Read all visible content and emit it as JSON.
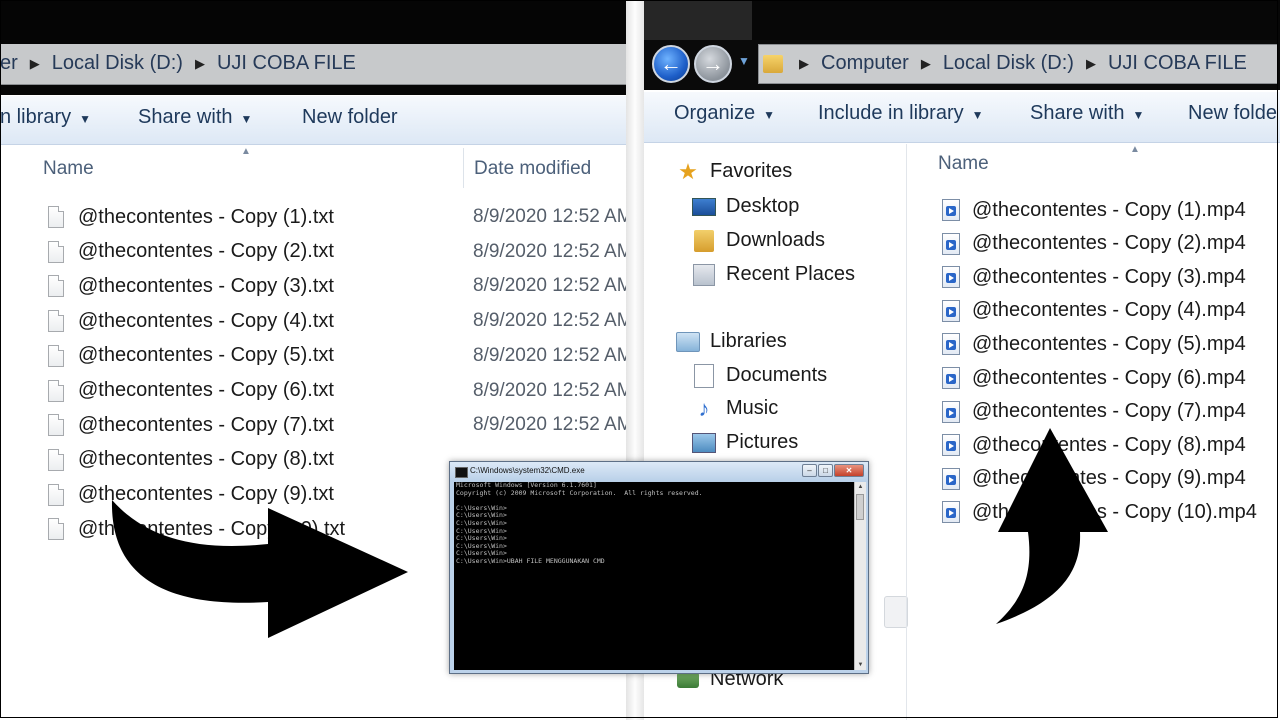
{
  "left_explorer": {
    "breadcrumbs": [
      "er",
      "Local Disk (D:)",
      "UJI COBA FILE"
    ],
    "toolbar": {
      "include_library": "n library",
      "share_with": "Share with",
      "new_folder": "New folder"
    },
    "columns": {
      "name": "Name",
      "date_modified": "Date modified"
    },
    "files": [
      {
        "name": "@thecontentes - Copy (1).txt",
        "date": "8/9/2020 12:52 AM"
      },
      {
        "name": "@thecontentes - Copy (2).txt",
        "date": "8/9/2020 12:52 AM"
      },
      {
        "name": "@thecontentes - Copy (3).txt",
        "date": "8/9/2020 12:52 AM"
      },
      {
        "name": "@thecontentes - Copy (4).txt",
        "date": "8/9/2020 12:52 AM"
      },
      {
        "name": "@thecontentes - Copy (5).txt",
        "date": "8/9/2020 12:52 AM"
      },
      {
        "name": "@thecontentes - Copy (6).txt",
        "date": "8/9/2020 12:52 AM"
      },
      {
        "name": "@thecontentes - Copy (7).txt",
        "date": "8/9/2020 12:52 AM"
      },
      {
        "name": "@thecontentes - Copy (8).txt",
        "date": ""
      },
      {
        "name": "@thecontentes - Copy (9).txt",
        "date": ""
      },
      {
        "name": "@thecontentes - Copy (10).txt",
        "date": ""
      }
    ]
  },
  "right_explorer": {
    "breadcrumbs": [
      "Computer",
      "Local Disk (D:)",
      "UJI COBA FILE"
    ],
    "toolbar": {
      "organize": "Organize",
      "include_library": "Include in library",
      "share_with": "Share with",
      "new_folder": "New folde"
    },
    "columns": {
      "name": "Name"
    },
    "nav": {
      "favorites": "Favorites",
      "desktop": "Desktop",
      "downloads": "Downloads",
      "recent_places": "Recent Places",
      "libraries": "Libraries",
      "documents": "Documents",
      "music": "Music",
      "pictures": "Pictures",
      "network": "Network"
    },
    "files": [
      "@thecontentes - Copy (1).mp4",
      "@thecontentes - Copy (2).mp4",
      "@thecontentes - Copy (3).mp4",
      "@thecontentes - Copy (4).mp4",
      "@thecontentes - Copy (5).mp4",
      "@thecontentes - Copy (6).mp4",
      "@thecontentes - Copy (7).mp4",
      "@thecontentes - Copy (8).mp4",
      "@thecontentes - Copy (9).mp4",
      "@thecontentes - Copy (10).mp4"
    ]
  },
  "cmd": {
    "title": "C:\\Windows\\system32\\CMD.exe",
    "lines": [
      "Microsoft Windows [Version 6.1.7601]",
      "Copyright (c) 2009 Microsoft Corporation.  All rights reserved.",
      "",
      "C:\\Users\\Win>",
      "C:\\Users\\Win>",
      "C:\\Users\\Win>",
      "C:\\Users\\Win>",
      "C:\\Users\\Win>",
      "C:\\Users\\Win>",
      "C:\\Users\\Win>",
      "C:\\Users\\Win>UBAH FILE MENGGUNAKAN CMD"
    ]
  },
  "colors": {
    "arrow": "#000000",
    "toolbar_text": "#1e395b",
    "console_bg": "#000000"
  }
}
